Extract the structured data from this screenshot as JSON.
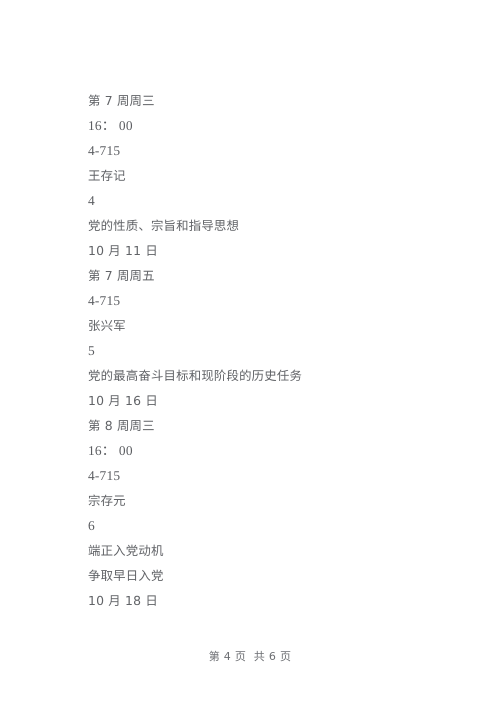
{
  "document": {
    "page_background": "#ffffff",
    "text_color": "#5f6165",
    "lines": [
      {
        "text": "第 7 周周三",
        "kind": "cjk"
      },
      {
        "text": "16： 00",
        "kind": "num"
      },
      {
        "text": "4-715",
        "kind": "num"
      },
      {
        "text": "王存记",
        "kind": "cjk"
      },
      {
        "text": "4",
        "kind": "num"
      },
      {
        "text": "党的性质、宗旨和指导思想",
        "kind": "cjk"
      },
      {
        "text": "10 月 11 日",
        "kind": "cjk"
      },
      {
        "text": "第 7 周周五",
        "kind": "cjk"
      },
      {
        "text": "4-715",
        "kind": "num"
      },
      {
        "text": "张兴军",
        "kind": "cjk"
      },
      {
        "text": "5",
        "kind": "num"
      },
      {
        "text": "党的最高奋斗目标和现阶段的历史任务",
        "kind": "cjk"
      },
      {
        "text": "10 月 16 日",
        "kind": "cjk"
      },
      {
        "text": "第 8 周周三",
        "kind": "cjk"
      },
      {
        "text": "16： 00",
        "kind": "num"
      },
      {
        "text": "4-715",
        "kind": "num"
      },
      {
        "text": "宗存元",
        "kind": "cjk"
      },
      {
        "text": "6",
        "kind": "num"
      },
      {
        "text": "端正入党动机",
        "kind": "cjk"
      },
      {
        "text": "争取早日入党",
        "kind": "cjk"
      },
      {
        "text": "10 月 18 日",
        "kind": "cjk"
      }
    ]
  },
  "footer": {
    "page_label": "第 4 页  共 6 页",
    "current_page": "4",
    "total_pages": "6"
  }
}
